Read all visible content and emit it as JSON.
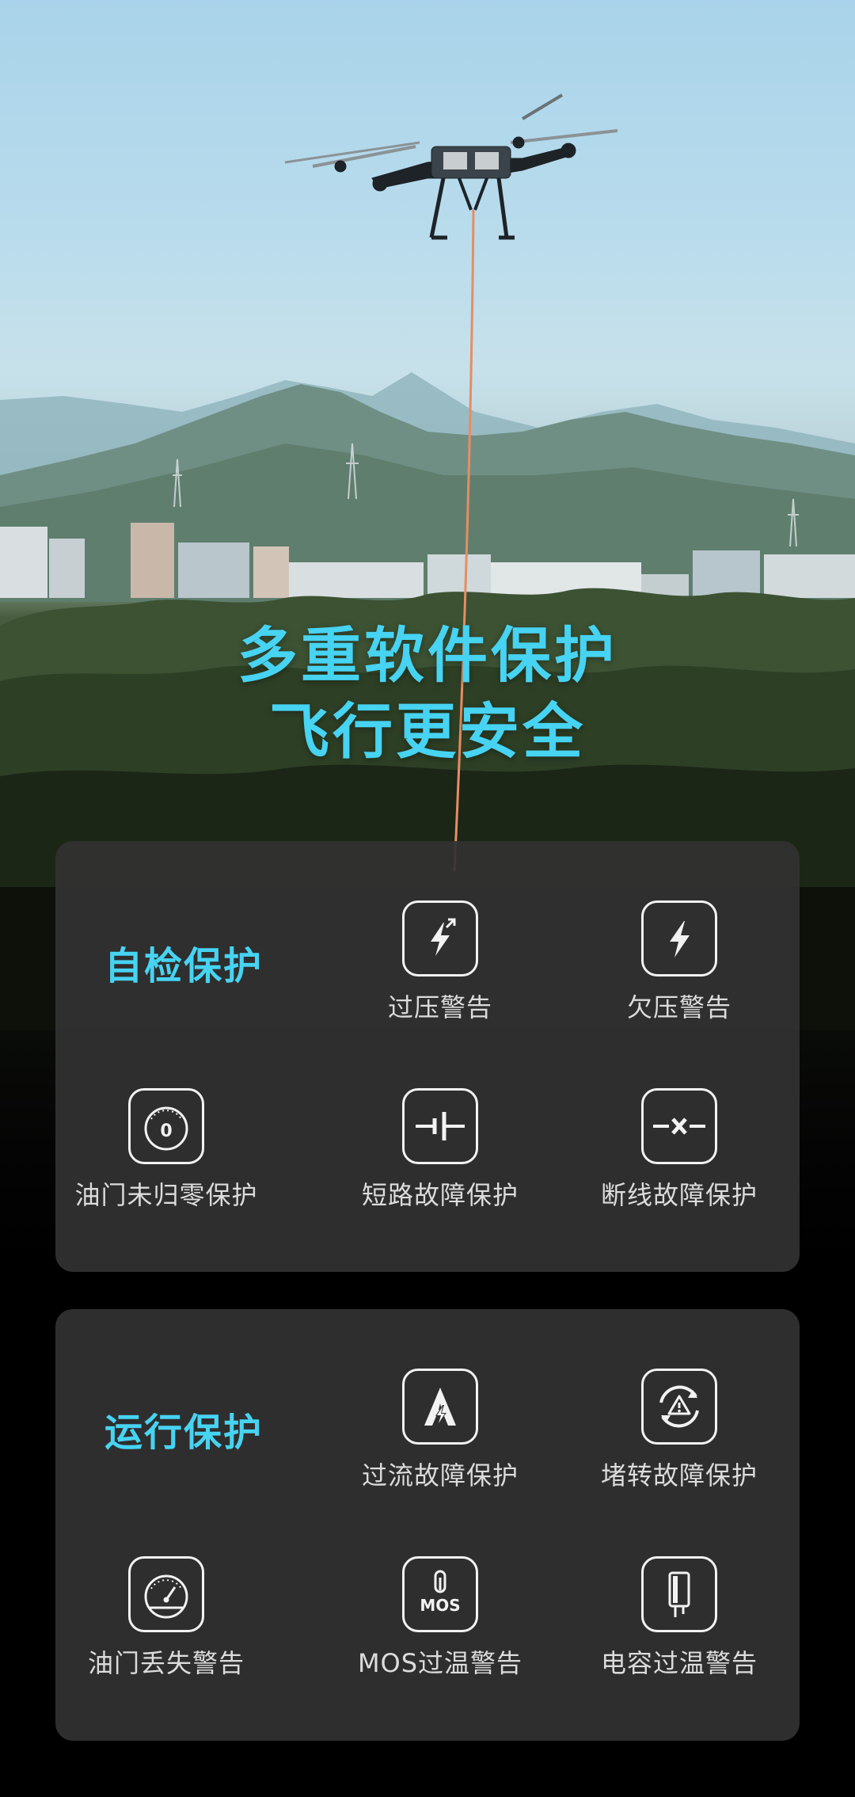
{
  "headline": {
    "line1": "多重软件保护",
    "line2": "飞行更安全"
  },
  "colors": {
    "accent": "#47d3f2",
    "panel": "#323232",
    "icon_stroke": "#f2f2f2",
    "label": "#dcdcdc"
  },
  "self_check": {
    "title": "自检保护",
    "items": [
      {
        "label": "过压警告",
        "icon": "lightning-arrow-up-icon"
      },
      {
        "label": "欠压警告",
        "icon": "lightning-icon"
      },
      {
        "label": "油门未归零保护",
        "icon": "throttle-zero-gauge-icon"
      },
      {
        "label": "短路故障保护",
        "icon": "short-circuit-icon"
      },
      {
        "label": "断线故障保护",
        "icon": "broken-wire-icon"
      }
    ]
  },
  "runtime": {
    "title": "运行保护",
    "items": [
      {
        "label": "过流故障保护",
        "icon": "overcurrent-icon"
      },
      {
        "label": "堵转故障保护",
        "icon": "stall-warning-icon"
      },
      {
        "label": "油门丢失警告",
        "icon": "throttle-gauge-icon"
      },
      {
        "label": "MOS过温警告",
        "icon": "mos-temperature-icon"
      },
      {
        "label": "电容过温警告",
        "icon": "capacitor-icon"
      }
    ]
  }
}
